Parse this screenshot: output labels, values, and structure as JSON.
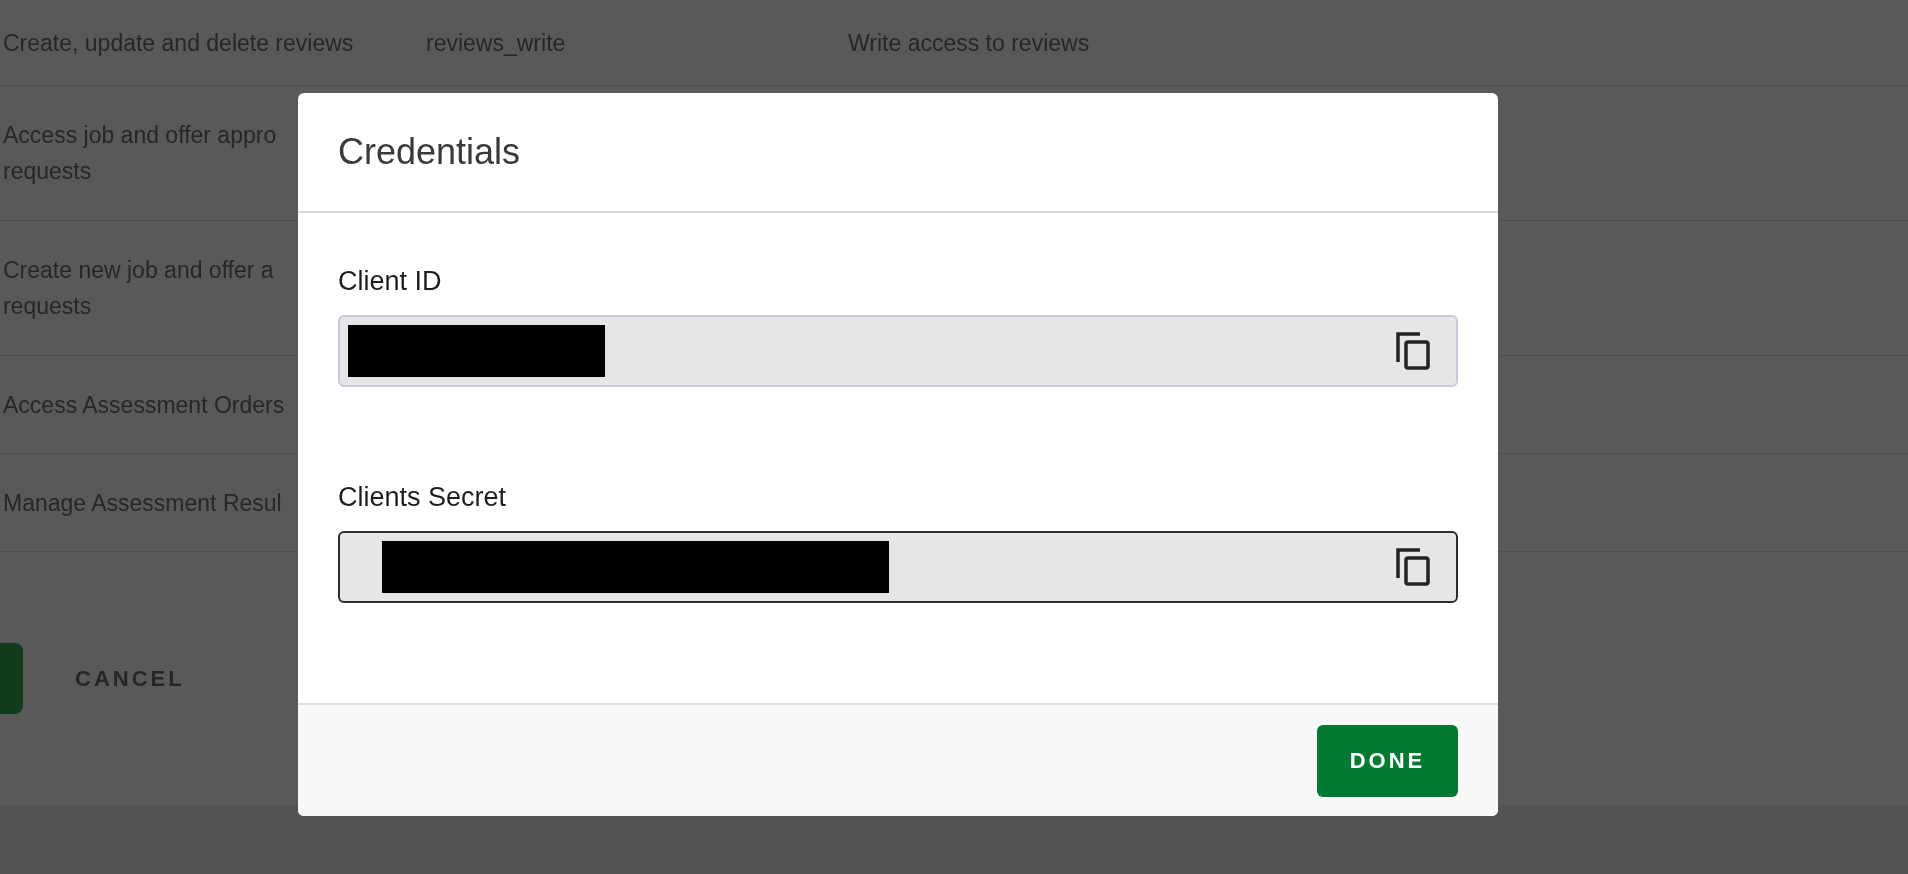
{
  "scopes_table": {
    "rows": [
      {
        "cells": [
          [
            "Create, update and delete reviews"
          ],
          [
            "reviews_write"
          ],
          [
            "Write access to reviews"
          ]
        ]
      },
      {
        "cells": [
          [
            "Access job and offer appro",
            "requests"
          ]
        ]
      },
      {
        "cells": [
          [
            "Create new job and offer a",
            "requests"
          ]
        ]
      },
      {
        "cells": [
          [
            "Access Assessment Orders"
          ]
        ]
      },
      {
        "cells": [
          [
            "Manage Assessment Resul"
          ]
        ]
      }
    ]
  },
  "form_actions": {
    "cancel": "CANCEL"
  },
  "dialog": {
    "title": "Credentials",
    "fields": [
      {
        "label": "Client ID",
        "redacted": true,
        "focused": false
      },
      {
        "label": "Clients Secret",
        "redacted": true,
        "focused": true
      }
    ],
    "done": "DONE"
  }
}
